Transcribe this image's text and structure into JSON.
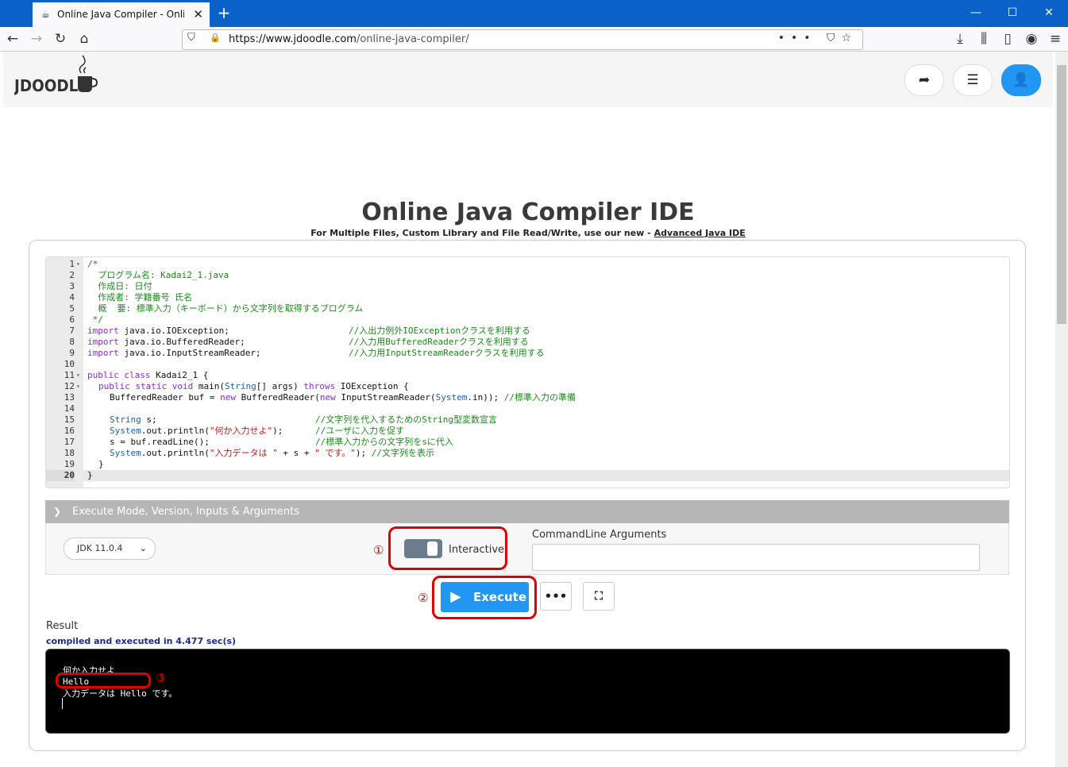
{
  "browser": {
    "tab_title": "Online Java Compiler - Online Ja",
    "url_host": "https://www.jdoodle.com",
    "url_path": "/online-java-compiler/"
  },
  "site": {
    "logo_text": "JDOODLE"
  },
  "page": {
    "title": "Online Java Compiler IDE",
    "subtitle_prefix": "For Multiple Files, Custom Library and File Read/Write, use our new -",
    "subtitle_link": "Advanced Java IDE"
  },
  "editor": {
    "lines": [
      {
        "n": "1",
        "fold": true
      },
      {
        "n": "2"
      },
      {
        "n": "3"
      },
      {
        "n": "4"
      },
      {
        "n": "5"
      },
      {
        "n": "6"
      },
      {
        "n": "7"
      },
      {
        "n": "8"
      },
      {
        "n": "9"
      },
      {
        "n": "10"
      },
      {
        "n": "11",
        "fold": true
      },
      {
        "n": "12",
        "fold": true
      },
      {
        "n": "13"
      },
      {
        "n": "14"
      },
      {
        "n": "15"
      },
      {
        "n": "16"
      },
      {
        "n": "17"
      },
      {
        "n": "18"
      },
      {
        "n": "19"
      },
      {
        "n": "20"
      }
    ],
    "code": {
      "l1": "/*",
      "l2": "  プログラム名: Kadai2_1.java",
      "l3": "  作成日: 日付",
      "l4": "  作成者: 学籍番号 氏名",
      "l5": "  概  要: 標準入力（キーボード）から文字列を取得するプログラム",
      "l6": " */",
      "l7_kw": "import",
      "l7_rest": " java.io.IOException;",
      "l7_cm": "//入出力例外IOExceptionクラスを利用する",
      "l8_kw": "import",
      "l8_rest": " java.io.BufferedReader;",
      "l8_cm": "//入力用BufferedReaderクラスを利用する",
      "l9_kw": "import",
      "l9_rest": " java.io.InputStreamReader;",
      "l9_cm": "//入力用InputStreamReaderクラスを利用する",
      "l11_kw": "public class",
      "l11_rest": " Kadai2_1 {",
      "l12_kw1": "public static void",
      "l12_mid": " main(",
      "l12_typ": "String",
      "l12_mid2": "[] args) ",
      "l12_kw2": "throws",
      "l12_rest": " IOException {",
      "l13_a": "BufferedReader buf = ",
      "l13_kw": "new",
      "l13_b": " BufferedReader(",
      "l13_kw2": "new",
      "l13_c": " InputStreamReader(",
      "l13_typ": "System",
      "l13_d": ".in)); ",
      "l13_cm": "//標準入力の準備",
      "l15_typ": "String",
      "l15_rest": " s;",
      "l15_cm": "//文字列を代入するためのString型変数宣言",
      "l16_typ": "System",
      "l16_a": ".out.println(",
      "l16_str": "\"何か入力せよ\"",
      "l16_b": ");",
      "l16_cm": "//ユーザに入力を促す",
      "l17_a": "s = buf.readLine();",
      "l17_cm": "//標準入力からの文字列をsに代入",
      "l18_typ": "System",
      "l18_a": ".out.println(",
      "l18_str1": "\"入力データは \"",
      "l18_b": " + s + ",
      "l18_str2": "\" です。\"",
      "l18_c": "); ",
      "l18_cm": "//文字列を表示",
      "l19": "}",
      "l20": "}"
    }
  },
  "execute_section": {
    "header": "Execute Mode, Version, Inputs & Arguments",
    "jdk_version": "JDK 11.0.4",
    "mode_label": "Interactive",
    "args_label": "CommandLine Arguments",
    "args_value": "",
    "execute_label": "Execute",
    "more_label": "•••"
  },
  "result": {
    "label": "Result",
    "status": "compiled and executed in 4.477 sec(s)",
    "output": [
      "何か入力せよ",
      "Hello",
      "入力データは Hello です。"
    ]
  },
  "annotations": {
    "n1": "①",
    "n2": "②",
    "n3": "③"
  },
  "colors": {
    "accent": "#2196f3",
    "annotation": "#e00000",
    "browser_tabstrip": "#0a62c9"
  }
}
